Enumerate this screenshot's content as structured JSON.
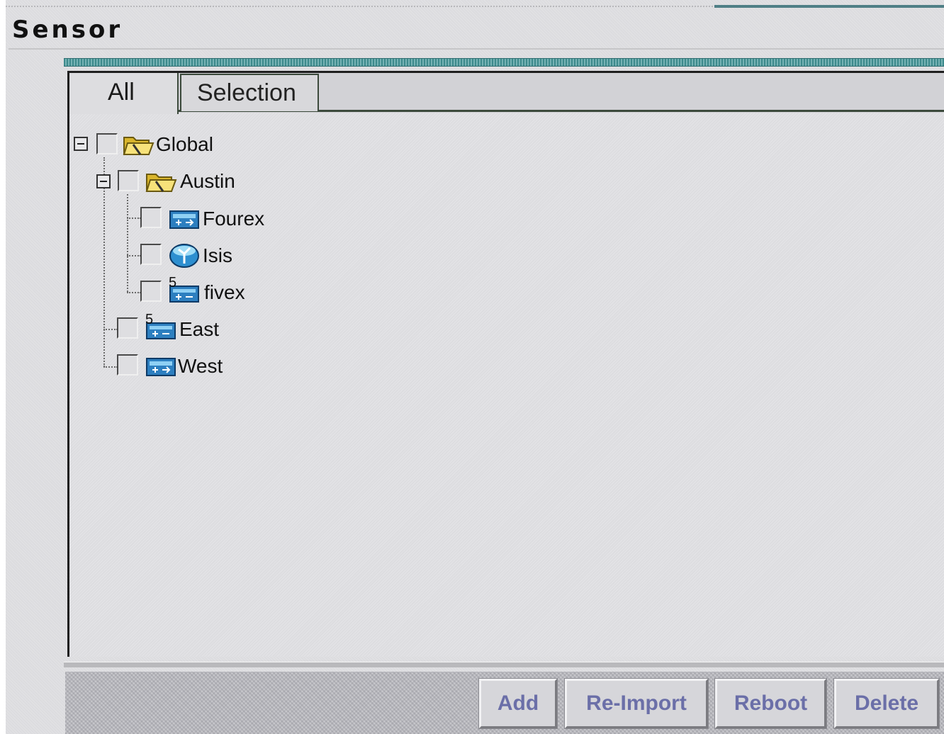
{
  "header": {
    "title": "Sensor"
  },
  "tabs": [
    {
      "label": "All",
      "selected": true
    },
    {
      "label": "Selection",
      "selected": false
    }
  ],
  "tree": {
    "global": {
      "label": "Global",
      "expanded": true,
      "checked": false,
      "icon": "folder-open-icon"
    },
    "austin": {
      "label": "Austin",
      "expanded": true,
      "checked": false,
      "icon": "folder-open-icon"
    },
    "fourex": {
      "label": "Fourex",
      "checked": false,
      "icon": "sensor-device-icon"
    },
    "isis": {
      "label": "Isis",
      "checked": false,
      "icon": "router-globe-icon"
    },
    "fivex": {
      "label": "fivex",
      "checked": false,
      "icon": "sensor-device-icon",
      "badge": "5"
    },
    "east": {
      "label": "East",
      "checked": false,
      "icon": "sensor-device-icon",
      "badge": "5"
    },
    "west": {
      "label": "West",
      "checked": false,
      "icon": "sensor-device-icon"
    }
  },
  "actions": {
    "add": "Add",
    "reimport": "Re-Import",
    "reboot": "Reboot",
    "delete": "Delete"
  },
  "colors": {
    "accent_teal": "#3d8a8c",
    "button_text": "#6b6fa8",
    "folder_yellow": "#f2d64b",
    "device_blue": "#2d7fc0"
  }
}
